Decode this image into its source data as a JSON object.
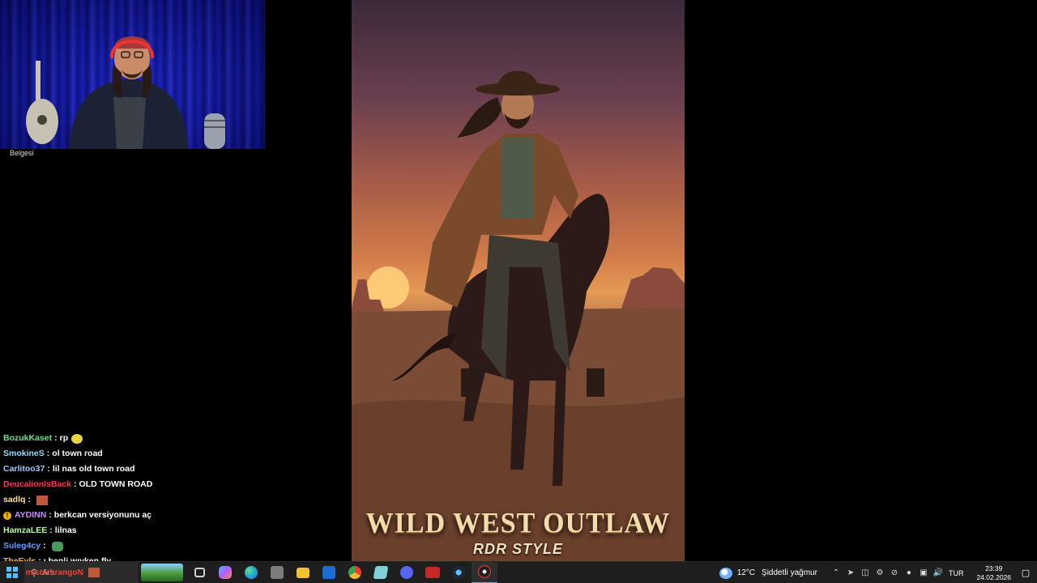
{
  "webcam": {
    "caption": "Belgesi"
  },
  "poster": {
    "title": "WILD WEST OUTLAW",
    "subtitle": "RDR STYLE"
  },
  "chat": {
    "messages": [
      {
        "user": "BozukKaset",
        "user_color": "#6de08a",
        "text": "rp",
        "emote": "emote-yellow"
      },
      {
        "user": "SmokineS",
        "user_color": "#8fdcff",
        "text": "ol town road"
      },
      {
        "user": "Carlitoo37",
        "user_color": "#a7c7ff",
        "text": "lil nas old town road"
      },
      {
        "user": "DeucalionIsBack",
        "user_color": "#ff2e55",
        "text": "OLD TOWN ROAD"
      },
      {
        "user": "sadlq",
        "user_color": "#ffe38a",
        "text": "",
        "emote": "emote-image"
      },
      {
        "user": "AYDINN",
        "user_color": "#c78cff",
        "text": "berkcan versiyonunu aç",
        "badge": "!"
      },
      {
        "user": "HamzaLEE",
        "user_color": "#b7ff9a",
        "text": "lilnas"
      },
      {
        "user": "Suleg4cy",
        "user_color": "#5aa0ff",
        "text": "",
        "emote": "emote-green"
      },
      {
        "user": "TheEyls",
        "user_color": "#ffb347",
        "text": "ı benli wıyken fly"
      },
      {
        "user": "misterhrangoN",
        "user_color": "#ff3b3b",
        "text": "",
        "emote": "emote-image"
      }
    ]
  },
  "taskbar": {
    "search_placeholder": "Ara",
    "apps": [
      {
        "name": "taskview-icon",
        "color": "#cfcfcf"
      },
      {
        "name": "copilot-icon",
        "color": "#7a6cff"
      },
      {
        "name": "edge-icon",
        "color": "#1e9ae0"
      },
      {
        "name": "store-icon",
        "color": "#8c8c8c"
      },
      {
        "name": "file-explorer-icon",
        "color": "#f2c230"
      },
      {
        "name": "outlook-icon",
        "color": "#1b6ed1"
      },
      {
        "name": "chrome-icon",
        "color": "#e94235"
      },
      {
        "name": "notepad-icon",
        "color": "#7fd3d8"
      },
      {
        "name": "discord-icon",
        "color": "#5865f2"
      },
      {
        "name": "video-editor-icon",
        "color": "#c62828"
      },
      {
        "name": "steam-icon",
        "color": "#1b2838"
      },
      {
        "name": "obs-icon",
        "color": "#3a3a3a"
      }
    ],
    "weather": {
      "temp": "12°C",
      "condition": "Şiddetli yağmur"
    },
    "language": "TUR",
    "time": "23:39",
    "date": "24.02.2026"
  }
}
